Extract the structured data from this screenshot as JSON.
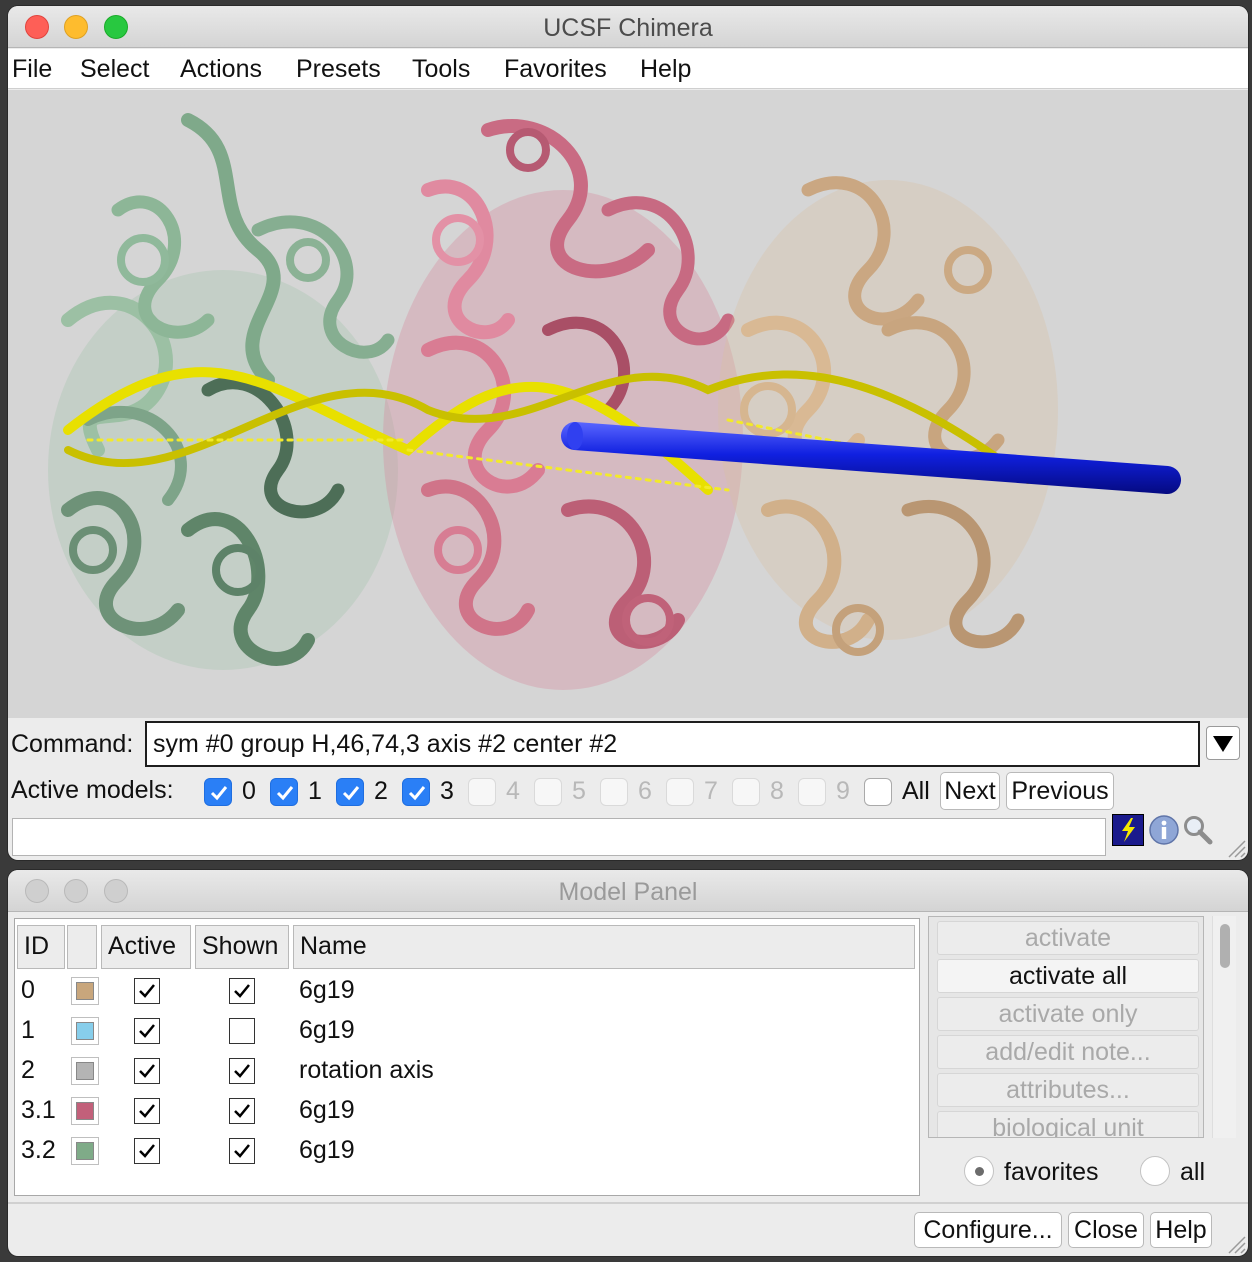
{
  "main_window": {
    "title": "UCSF Chimera",
    "menu": [
      "File",
      "Select",
      "Actions",
      "Presets",
      "Tools",
      "Favorites",
      "Help"
    ],
    "command_label": "Command:",
    "command_value": "sym #0 group H,46,74,3 axis #2 center #2",
    "active_models_label": "Active models:",
    "active_models": [
      {
        "num": "0",
        "checked": true,
        "enabled": true
      },
      {
        "num": "1",
        "checked": true,
        "enabled": true
      },
      {
        "num": "2",
        "checked": true,
        "enabled": true
      },
      {
        "num": "3",
        "checked": true,
        "enabled": true
      },
      {
        "num": "4",
        "checked": false,
        "enabled": false
      },
      {
        "num": "5",
        "checked": false,
        "enabled": false
      },
      {
        "num": "6",
        "checked": false,
        "enabled": false
      },
      {
        "num": "7",
        "checked": false,
        "enabled": false
      },
      {
        "num": "8",
        "checked": false,
        "enabled": false
      },
      {
        "num": "9",
        "checked": false,
        "enabled": false
      }
    ],
    "all_label": "All",
    "next_button": "Next",
    "previous_button": "Previous",
    "status_text": "",
    "colors": {
      "background": "#d5d5d5",
      "molecule_green": "#8fb39a",
      "molecule_pink": "#d27a8f",
      "molecule_tan": "#d6b48e",
      "dna_yellow": "#e8e000",
      "axis_blue": "#1020e0"
    }
  },
  "model_panel": {
    "title": "Model Panel",
    "columns": [
      "ID",
      "",
      "Active",
      "Shown",
      "Name"
    ],
    "rows": [
      {
        "id": "0",
        "color": "#c8a67c",
        "active": true,
        "shown": true,
        "name": "6g19"
      },
      {
        "id": "1",
        "color": "#87ceeb",
        "active": true,
        "shown": false,
        "name": "6g19"
      },
      {
        "id": "2",
        "color": "#b4b4b4",
        "active": true,
        "shown": true,
        "name": "rotation axis"
      },
      {
        "id": "3.1",
        "color": "#c2607a",
        "active": true,
        "shown": true,
        "name": "6g19"
      },
      {
        "id": "3.2",
        "color": "#7fab88",
        "active": true,
        "shown": true,
        "name": "6g19"
      }
    ],
    "commands": [
      {
        "label": "activate",
        "enabled": false
      },
      {
        "label": "activate all",
        "enabled": true
      },
      {
        "label": "activate only",
        "enabled": false
      },
      {
        "label": "add/edit note...",
        "enabled": false
      },
      {
        "label": "attributes...",
        "enabled": false
      },
      {
        "label": "biological unit",
        "enabled": false
      }
    ],
    "radio_favorites": "favorites",
    "radio_all": "all",
    "radio_selected": "favorites",
    "configure_button": "Configure...",
    "close_button": "Close",
    "help_button": "Help"
  }
}
